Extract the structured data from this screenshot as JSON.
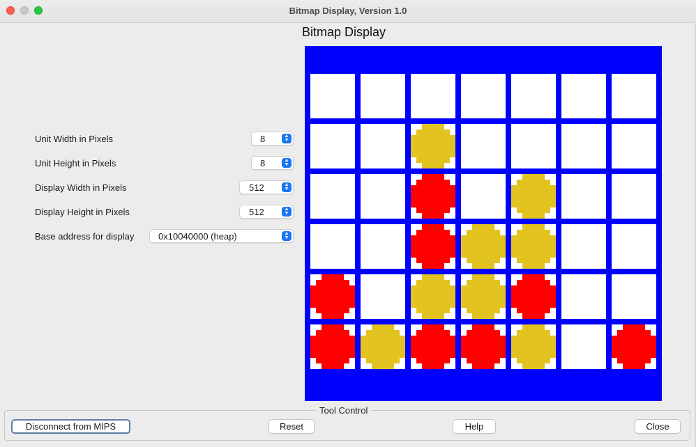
{
  "window": {
    "title": "Bitmap Display, Version 1.0"
  },
  "display": {
    "title": "Bitmap Display"
  },
  "settings": [
    {
      "label": "Unit Width in Pixels",
      "value": "8"
    },
    {
      "label": "Unit Height in Pixels",
      "value": "8"
    },
    {
      "label": "Display Width in Pixels",
      "value": "512"
    },
    {
      "label": "Display Height in Pixels",
      "value": "512"
    },
    {
      "label": "Base address for display",
      "value": "0x10040000 (heap)"
    }
  ],
  "board": {
    "rows": 6,
    "cols": 7,
    "cells": [
      [
        "empty",
        "empty",
        "empty",
        "empty",
        "empty",
        "empty",
        "empty"
      ],
      [
        "empty",
        "empty",
        "yellow",
        "empty",
        "empty",
        "empty",
        "empty"
      ],
      [
        "empty",
        "empty",
        "red",
        "empty",
        "yellow",
        "empty",
        "empty"
      ],
      [
        "empty",
        "empty",
        "red",
        "yellow",
        "yellow",
        "empty",
        "empty"
      ],
      [
        "red",
        "empty",
        "yellow",
        "yellow",
        "red",
        "empty",
        "empty"
      ],
      [
        "red",
        "yellow",
        "red",
        "red",
        "yellow",
        "empty",
        "red"
      ]
    ],
    "colors": {
      "background": "#0000ff",
      "cell": "#ffffff",
      "red": "#ff0000",
      "yellow": "#e3c31f"
    }
  },
  "tool_control": {
    "label": "Tool Control",
    "buttons": {
      "disconnect": "Disconnect from MIPS",
      "reset": "Reset",
      "help": "Help",
      "close": "Close"
    }
  }
}
